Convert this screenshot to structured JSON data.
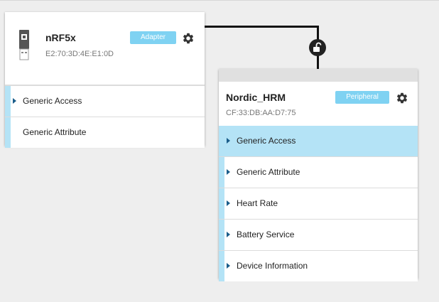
{
  "adapter": {
    "name": "nRF5x",
    "address": "E2:70:3D:4E:E1:0D",
    "badge": "Adapter",
    "icon": "usb-dongle-icon",
    "services": [
      {
        "label": "Generic Access",
        "expandable": true
      },
      {
        "label": "Generic Attribute",
        "expandable": false
      }
    ]
  },
  "peripheral": {
    "name": "Nordic_HRM",
    "address": "CF:33:DB:AA:D7:75",
    "badge": "Peripheral",
    "services": [
      {
        "label": "Generic Access",
        "selected": true
      },
      {
        "label": "Generic Attribute"
      },
      {
        "label": "Heart Rate"
      },
      {
        "label": "Battery Service"
      },
      {
        "label": "Device Information"
      }
    ]
  },
  "connection": {
    "icon": "unlocked-padlock-icon"
  },
  "colors": {
    "badge": "#7fd2f2",
    "selected_row": "#b4e3f6",
    "caret": "#1a5d8a"
  }
}
